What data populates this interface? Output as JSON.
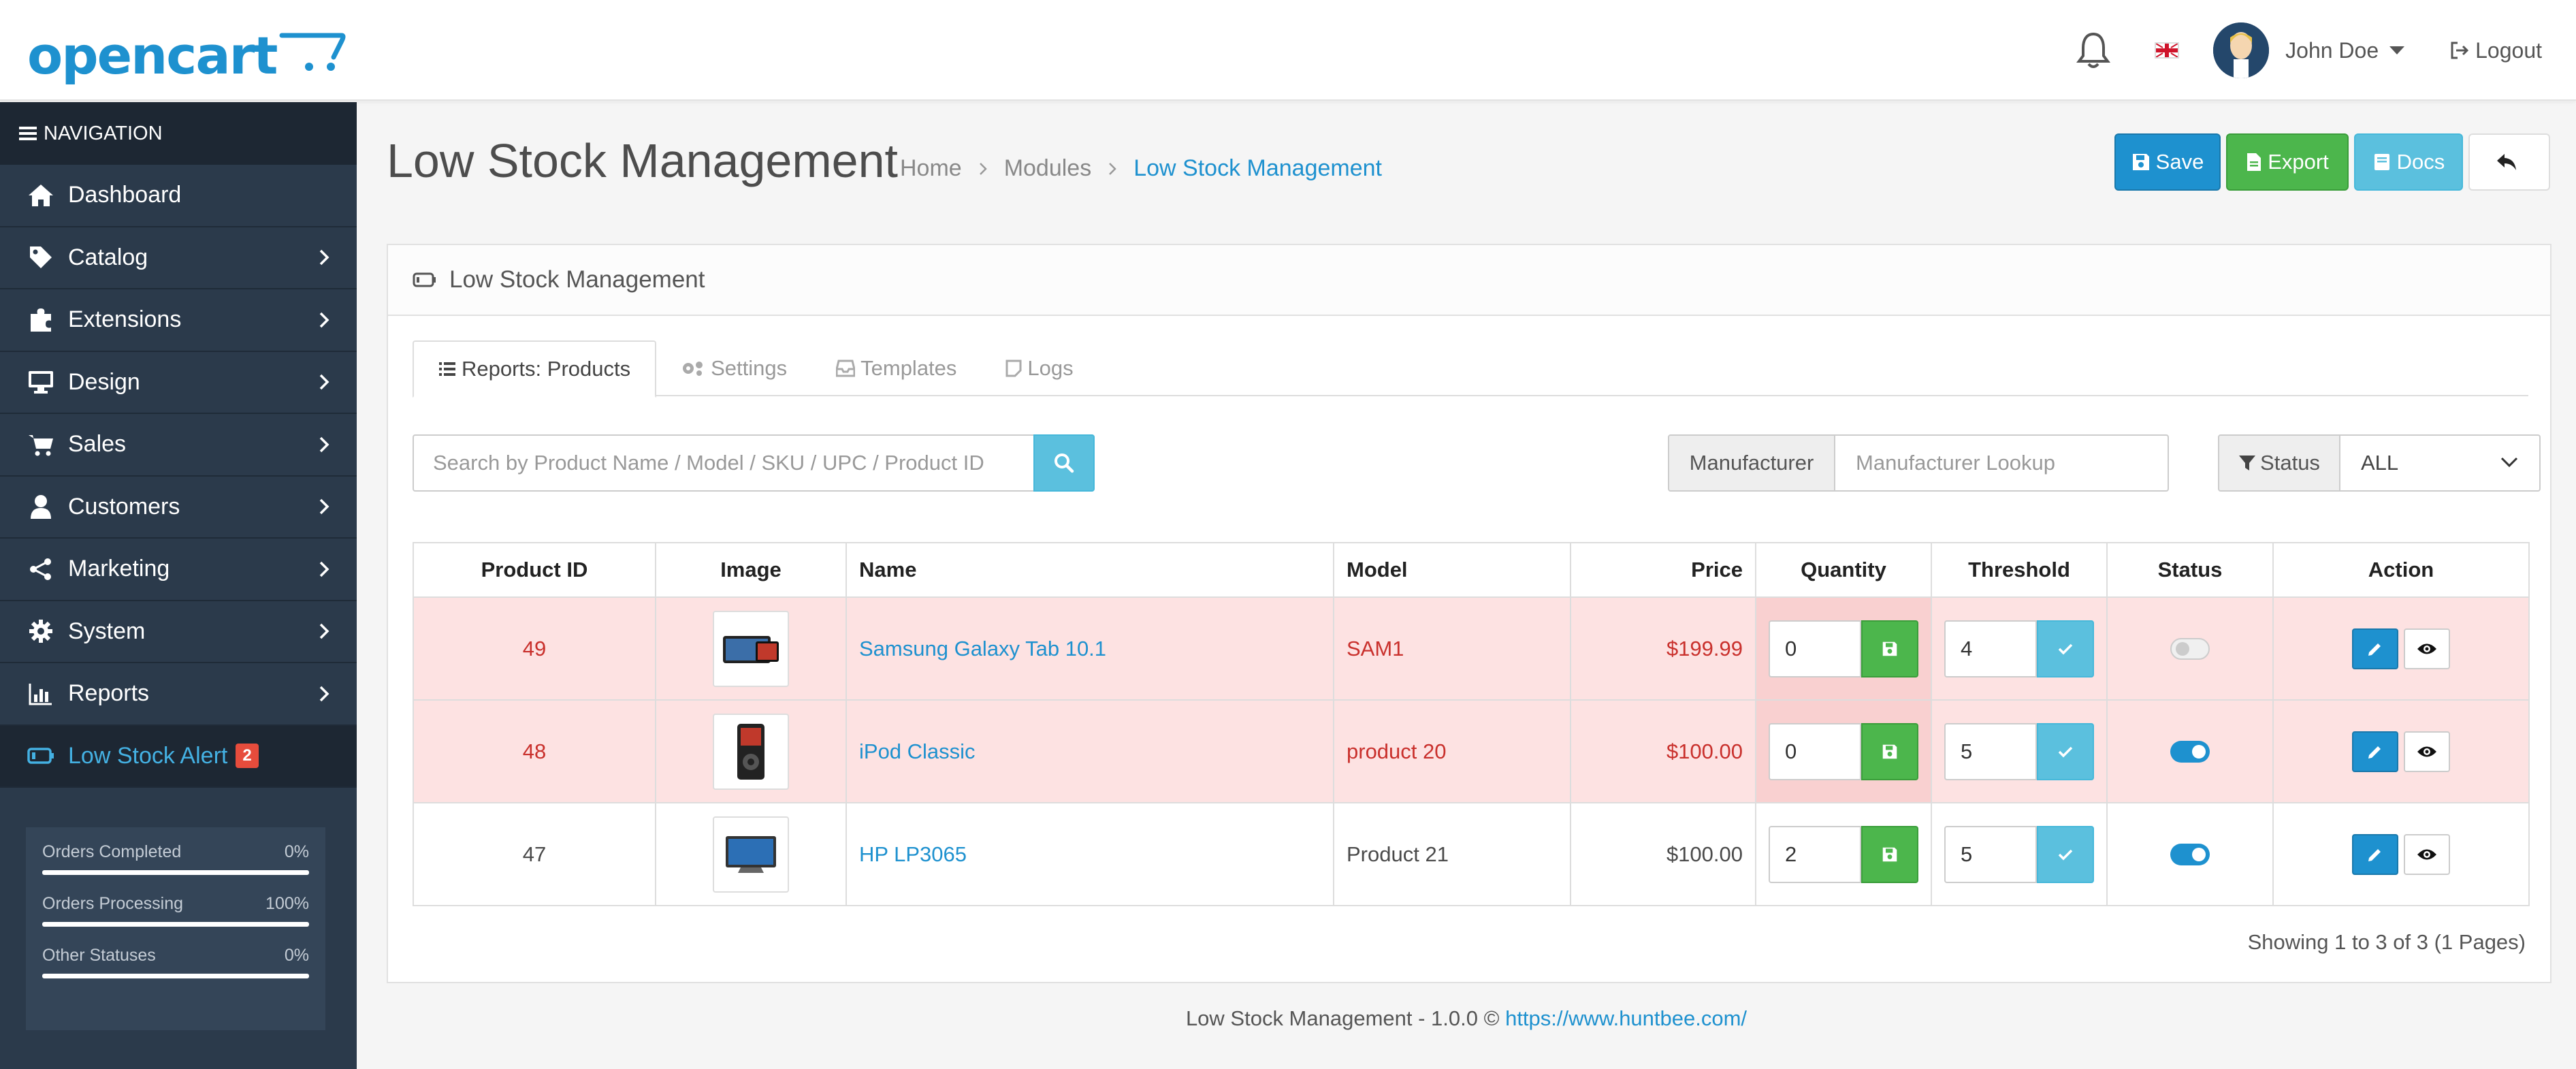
{
  "header": {
    "logo_text": "opencart",
    "user_name": "John Doe",
    "logout_label": "Logout"
  },
  "sidebar": {
    "nav_title": "NAVIGATION",
    "items": [
      {
        "label": "Dashboard",
        "icon": "home-icon"
      },
      {
        "label": "Catalog",
        "icon": "tag-icon"
      },
      {
        "label": "Extensions",
        "icon": "puzzle-icon"
      },
      {
        "label": "Design",
        "icon": "monitor-icon"
      },
      {
        "label": "Sales",
        "icon": "cart-icon"
      },
      {
        "label": "Customers",
        "icon": "user-icon"
      },
      {
        "label": "Marketing",
        "icon": "share-icon"
      },
      {
        "label": "System",
        "icon": "gear-icon"
      },
      {
        "label": "Reports",
        "icon": "bar-chart-icon"
      }
    ],
    "active_item": {
      "label": "Low Stock Alert",
      "badge": "2",
      "icon": "battery-icon"
    },
    "stats": [
      {
        "label": "Orders Completed",
        "value": "0%"
      },
      {
        "label": "Orders Processing",
        "value": "100%"
      },
      {
        "label": "Other Statuses",
        "value": "0%"
      }
    ]
  },
  "page": {
    "title": "Low Stock Management",
    "breadcrumb": [
      "Home",
      "Modules",
      "Low Stock Management"
    ],
    "buttons": {
      "save": "Save",
      "export": "Export",
      "docs": "Docs"
    },
    "panel_title": "Low Stock Management",
    "tabs": [
      "Reports: Products",
      "Settings",
      "Templates",
      "Logs"
    ],
    "search_placeholder": "Search by Product Name / Model / SKU / UPC / Product ID",
    "manufacturer_label": "Manufacturer",
    "manufacturer_placeholder": "Manufacturer Lookup",
    "status_label": "Status",
    "status_value": "ALL"
  },
  "table": {
    "columns": [
      "Product ID",
      "Image",
      "Name",
      "Model",
      "Price",
      "Quantity",
      "Threshold",
      "Status",
      "Action"
    ],
    "rows": [
      {
        "id": "49",
        "name": "Samsung Galaxy Tab 10.1",
        "model": "SAM1",
        "price": "$199.99",
        "quantity": "0",
        "threshold": "4",
        "status": "off",
        "low": true
      },
      {
        "id": "48",
        "name": "iPod Classic",
        "model": "product 20",
        "price": "$100.00",
        "quantity": "0",
        "threshold": "5",
        "status": "on",
        "low": true
      },
      {
        "id": "47",
        "name": "HP LP3065",
        "model": "Product 21",
        "price": "$100.00",
        "quantity": "2",
        "threshold": "5",
        "status": "on",
        "low": false
      }
    ],
    "showing": "Showing 1 to 3 of 3 (1 Pages)"
  },
  "footer": {
    "text": "Low Stock Management - 1.0.0 © ",
    "link": "https://www.huntbee.com/"
  },
  "colors": {
    "brand": "#1e91cf",
    "sidebar_bg": "#2b3a4b",
    "success": "#4cb64c",
    "info": "#5bc0de",
    "danger_row": "#fde2e2"
  }
}
